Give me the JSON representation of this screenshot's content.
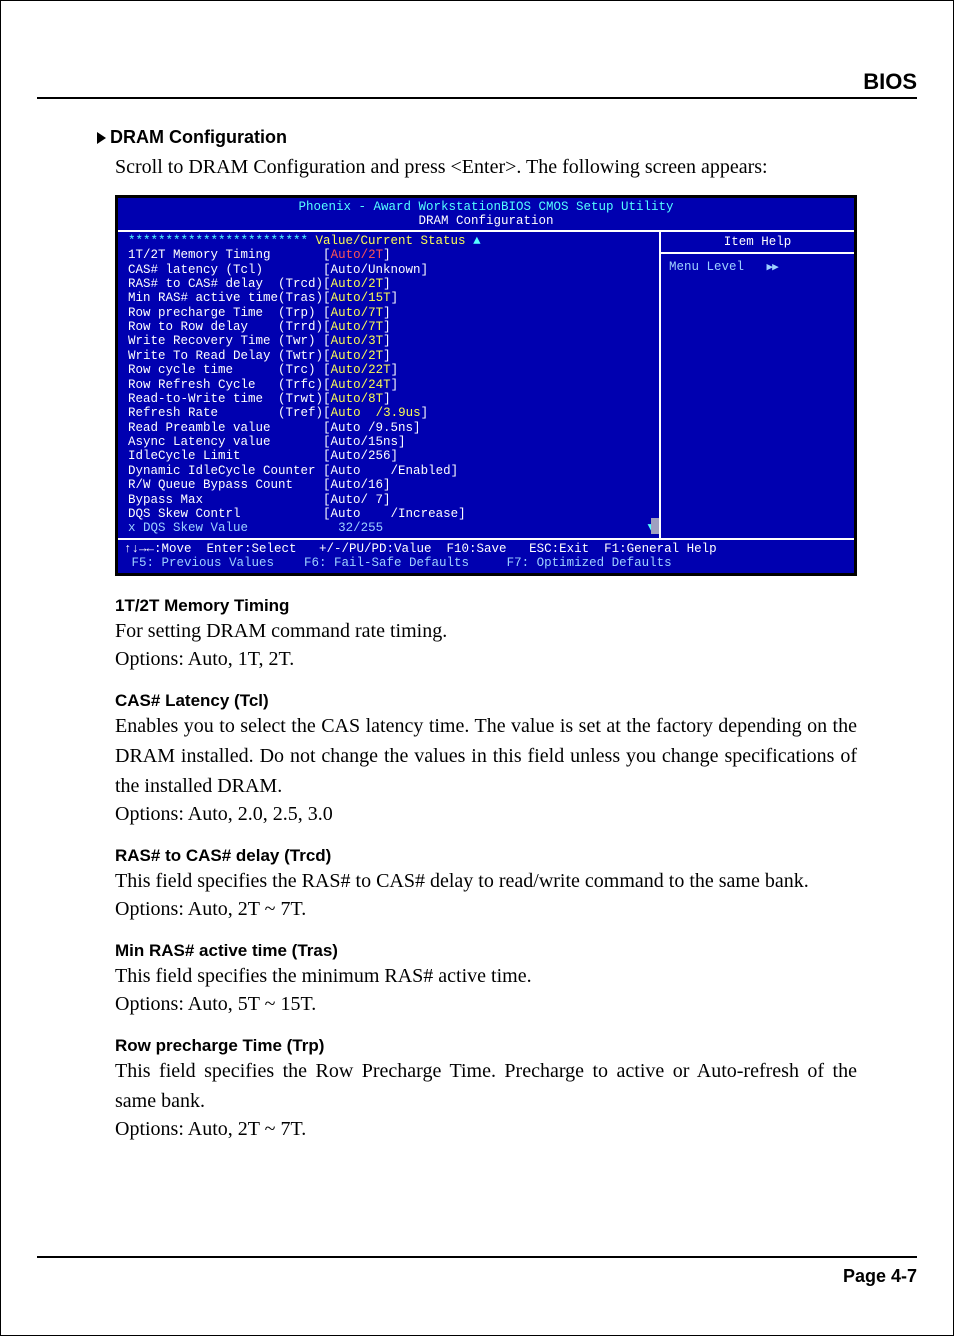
{
  "header": {
    "title": "BIOS"
  },
  "section": {
    "heading": "DRAM Configuration",
    "intro": "Scroll to DRAM Configuration and press <Enter>. The following screen appears:"
  },
  "bios": {
    "title_line1": "Phoenix - Award WorkstationBIOS CMOS Setup Utility",
    "title_line2": "DRAM Configuration",
    "header_stars": "************************",
    "header_text": " Value/Current Status ",
    "rows": [
      {
        "label": "1T/2T Memory Timing       ",
        "val": "[",
        "hi": "Auto/2T",
        "tail": "]"
      },
      {
        "label": "CAS# latency (Tcl)        ",
        "val": "[Auto/Unknown]"
      },
      {
        "label": "RAS# to CAS# delay  (Trcd)",
        "val": "[",
        "hi": "Auto/2T",
        "tail": "]"
      },
      {
        "label": "Min RAS# active time(Tras)",
        "val": "[",
        "hi": "Auto/15T",
        "tail": "]"
      },
      {
        "label": "Row precharge Time  (Trp) ",
        "val": "[",
        "hi": "Auto/7T",
        "tail": "]"
      },
      {
        "label": "Row to Row delay    (Trrd)",
        "val": "[",
        "hi": "Auto/7T",
        "tail": "]"
      },
      {
        "label": "Write Recovery Time (Twr) ",
        "val": "[",
        "hi": "Auto/3T",
        "tail": "]"
      },
      {
        "label": "Write To Read Delay (Twtr)",
        "val": "[",
        "hi": "Auto/2T",
        "tail": "]"
      },
      {
        "label": "Row cycle time      (Trc) ",
        "val": "[",
        "hi": "Auto/22T",
        "tail": "]"
      },
      {
        "label": "Row Refresh Cycle   (Trfc)",
        "val": "[",
        "hi": "Auto/24T",
        "tail": "]"
      },
      {
        "label": "Read-to-Write time  (Trwt)",
        "val": "[",
        "hi": "Auto/8T",
        "tail": "]"
      },
      {
        "label": "Refresh Rate        (Tref)",
        "val": "[",
        "hi": "Auto  /3.9us",
        "tail": "]"
      },
      {
        "label": "Read Preamble value       ",
        "val": "[Auto /9.5ns]"
      },
      {
        "label": "Async Latency value       ",
        "val": "[Auto/15ns]"
      },
      {
        "label": "IdleCycle Limit           ",
        "val": "[Auto/256]"
      },
      {
        "label": "Dynamic IdleCycle Counter ",
        "val": "[Auto    /Enabled]"
      },
      {
        "label": "R/W Queue Bypass Count    ",
        "val": "[Auto/16]"
      },
      {
        "label": "Bypass Max                ",
        "val": "[Auto/ 7]"
      },
      {
        "label": "DQS Skew Contrl           ",
        "val": "[Auto    /Increase]"
      }
    ],
    "x_row": {
      "prefix": "x ",
      "label": "DQS Skew Value            ",
      "val": "32/255"
    },
    "help": {
      "title": "Item Help",
      "menu_level": "Menu Level"
    },
    "footer_line1_left": "↑↓→←:Move  Enter:Select   +/-/PU/PD:Value  F10:Save",
    "footer_line1_right": "ESC:Exit  F1:General Help",
    "footer_line2_left": " F5: Previous Values    F6: Fail-Safe Defaults    ",
    "footer_line2_right": "F7: Optimized Defaults"
  },
  "descs": [
    {
      "heading": "1T/2T Memory Timing",
      "body": "For setting DRAM command rate timing.",
      "options": "Options: Auto, 1T, 2T."
    },
    {
      "heading": "CAS# Latency (Tcl)",
      "body": "Enables you to select the CAS latency time. The value is set at the factory depending on the DRAM installed. Do not change the values in this field unless you change specifications of the installed DRAM.",
      "options": "Options: Auto, 2.0, 2.5, 3.0"
    },
    {
      "heading": "RAS# to CAS# delay (Trcd)",
      "body": "This field specifies the RAS# to CAS# delay to read/write command to the same bank.",
      "options": "Options: Auto, 2T ~ 7T."
    },
    {
      "heading": "Min RAS# active time (Tras)",
      "body": "This field specifies the minimum RAS# active time.",
      "options": "Options: Auto, 5T ~ 15T."
    },
    {
      "heading": "Row precharge Time (Trp)",
      "body": "This field specifies the Row Precharge Time. Precharge to active or Auto-refresh of the same bank.",
      "options": "Options: Auto, 2T ~ 7T."
    }
  ],
  "footer": {
    "page": "Page 4-7"
  }
}
